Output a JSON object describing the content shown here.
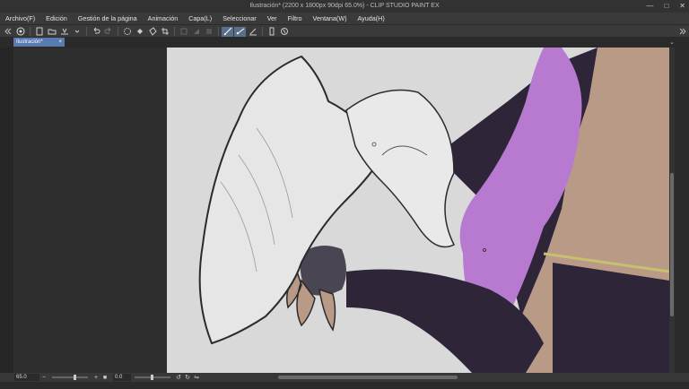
{
  "window": {
    "title": "Ilustración* (2200 x 1800px 90dpi 65.0%) - CLIP STUDIO PAINT EX"
  },
  "menu": [
    "Archivo(F)",
    "Edición",
    "Gestión de la página",
    "Animación",
    "Capa(L)",
    "Seleccionar",
    "Ver",
    "Filtro",
    "Ventana(W)",
    "Ayuda(H)"
  ],
  "document_tab": {
    "label": "Ilustración*",
    "close": "×"
  },
  "status": {
    "zoom": "65.0",
    "rotation": "0.0"
  },
  "colors": {
    "canvas_bg": "#d9d9d9",
    "hair": "#b77ad0",
    "sleeve": "#2e2538",
    "skin": "#b89a86",
    "outline": "#2b2b2b",
    "accent": "#5a7bb0"
  }
}
